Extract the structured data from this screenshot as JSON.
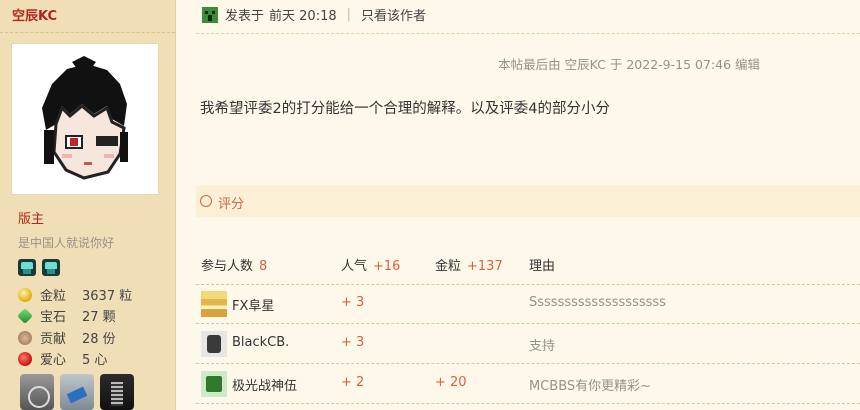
{
  "user": {
    "name": "空辰KC",
    "rank": "版主",
    "motto": "是中国人就说你好",
    "stats": [
      {
        "label": "金粒",
        "value": "3637 粒",
        "icon": "gold-nugget-icon"
      },
      {
        "label": "宝石",
        "value": "27 颗",
        "icon": "emerald-icon"
      },
      {
        "label": "贡献",
        "value": "28 份",
        "icon": "cookie-icon"
      },
      {
        "label": "爱心",
        "value": "5 心",
        "icon": "apple-icon"
      }
    ]
  },
  "post": {
    "posted_prefix": "发表于",
    "posted_time": "前天 20:18",
    "separator": "|",
    "only_author": "只看该作者",
    "edit_note": "本帖最后由 空辰KC 于 2022-9-15 07:46 编辑",
    "content": "我希望评委2的打分能给一个合理的解释。以及评委4的部分小分"
  },
  "rating": {
    "label": "评分",
    "header": {
      "people_label": "参与人数",
      "people_count": "8",
      "popularity_label": "人气",
      "popularity_total": "+16",
      "gold_label": "金粒",
      "gold_total": "+137",
      "reason_label": "理由"
    },
    "rows": [
      {
        "user": "FX阜星",
        "popularity": "+ 3",
        "gold": "",
        "reason": "Ssssssssssssssssssss"
      },
      {
        "user": "BlackCB.",
        "popularity": "+ 3",
        "gold": "",
        "reason": "支持"
      },
      {
        "user": "极光战神伍",
        "popularity": "+ 2",
        "gold": "+ 20",
        "reason": "MCBBS有你更精彩~"
      }
    ]
  },
  "colors": {
    "accent_red": "#b3251b",
    "rating_orange": "#e0603f",
    "sidebar_bg": "#f0dfb6",
    "main_bg": "#fdf8ea"
  }
}
